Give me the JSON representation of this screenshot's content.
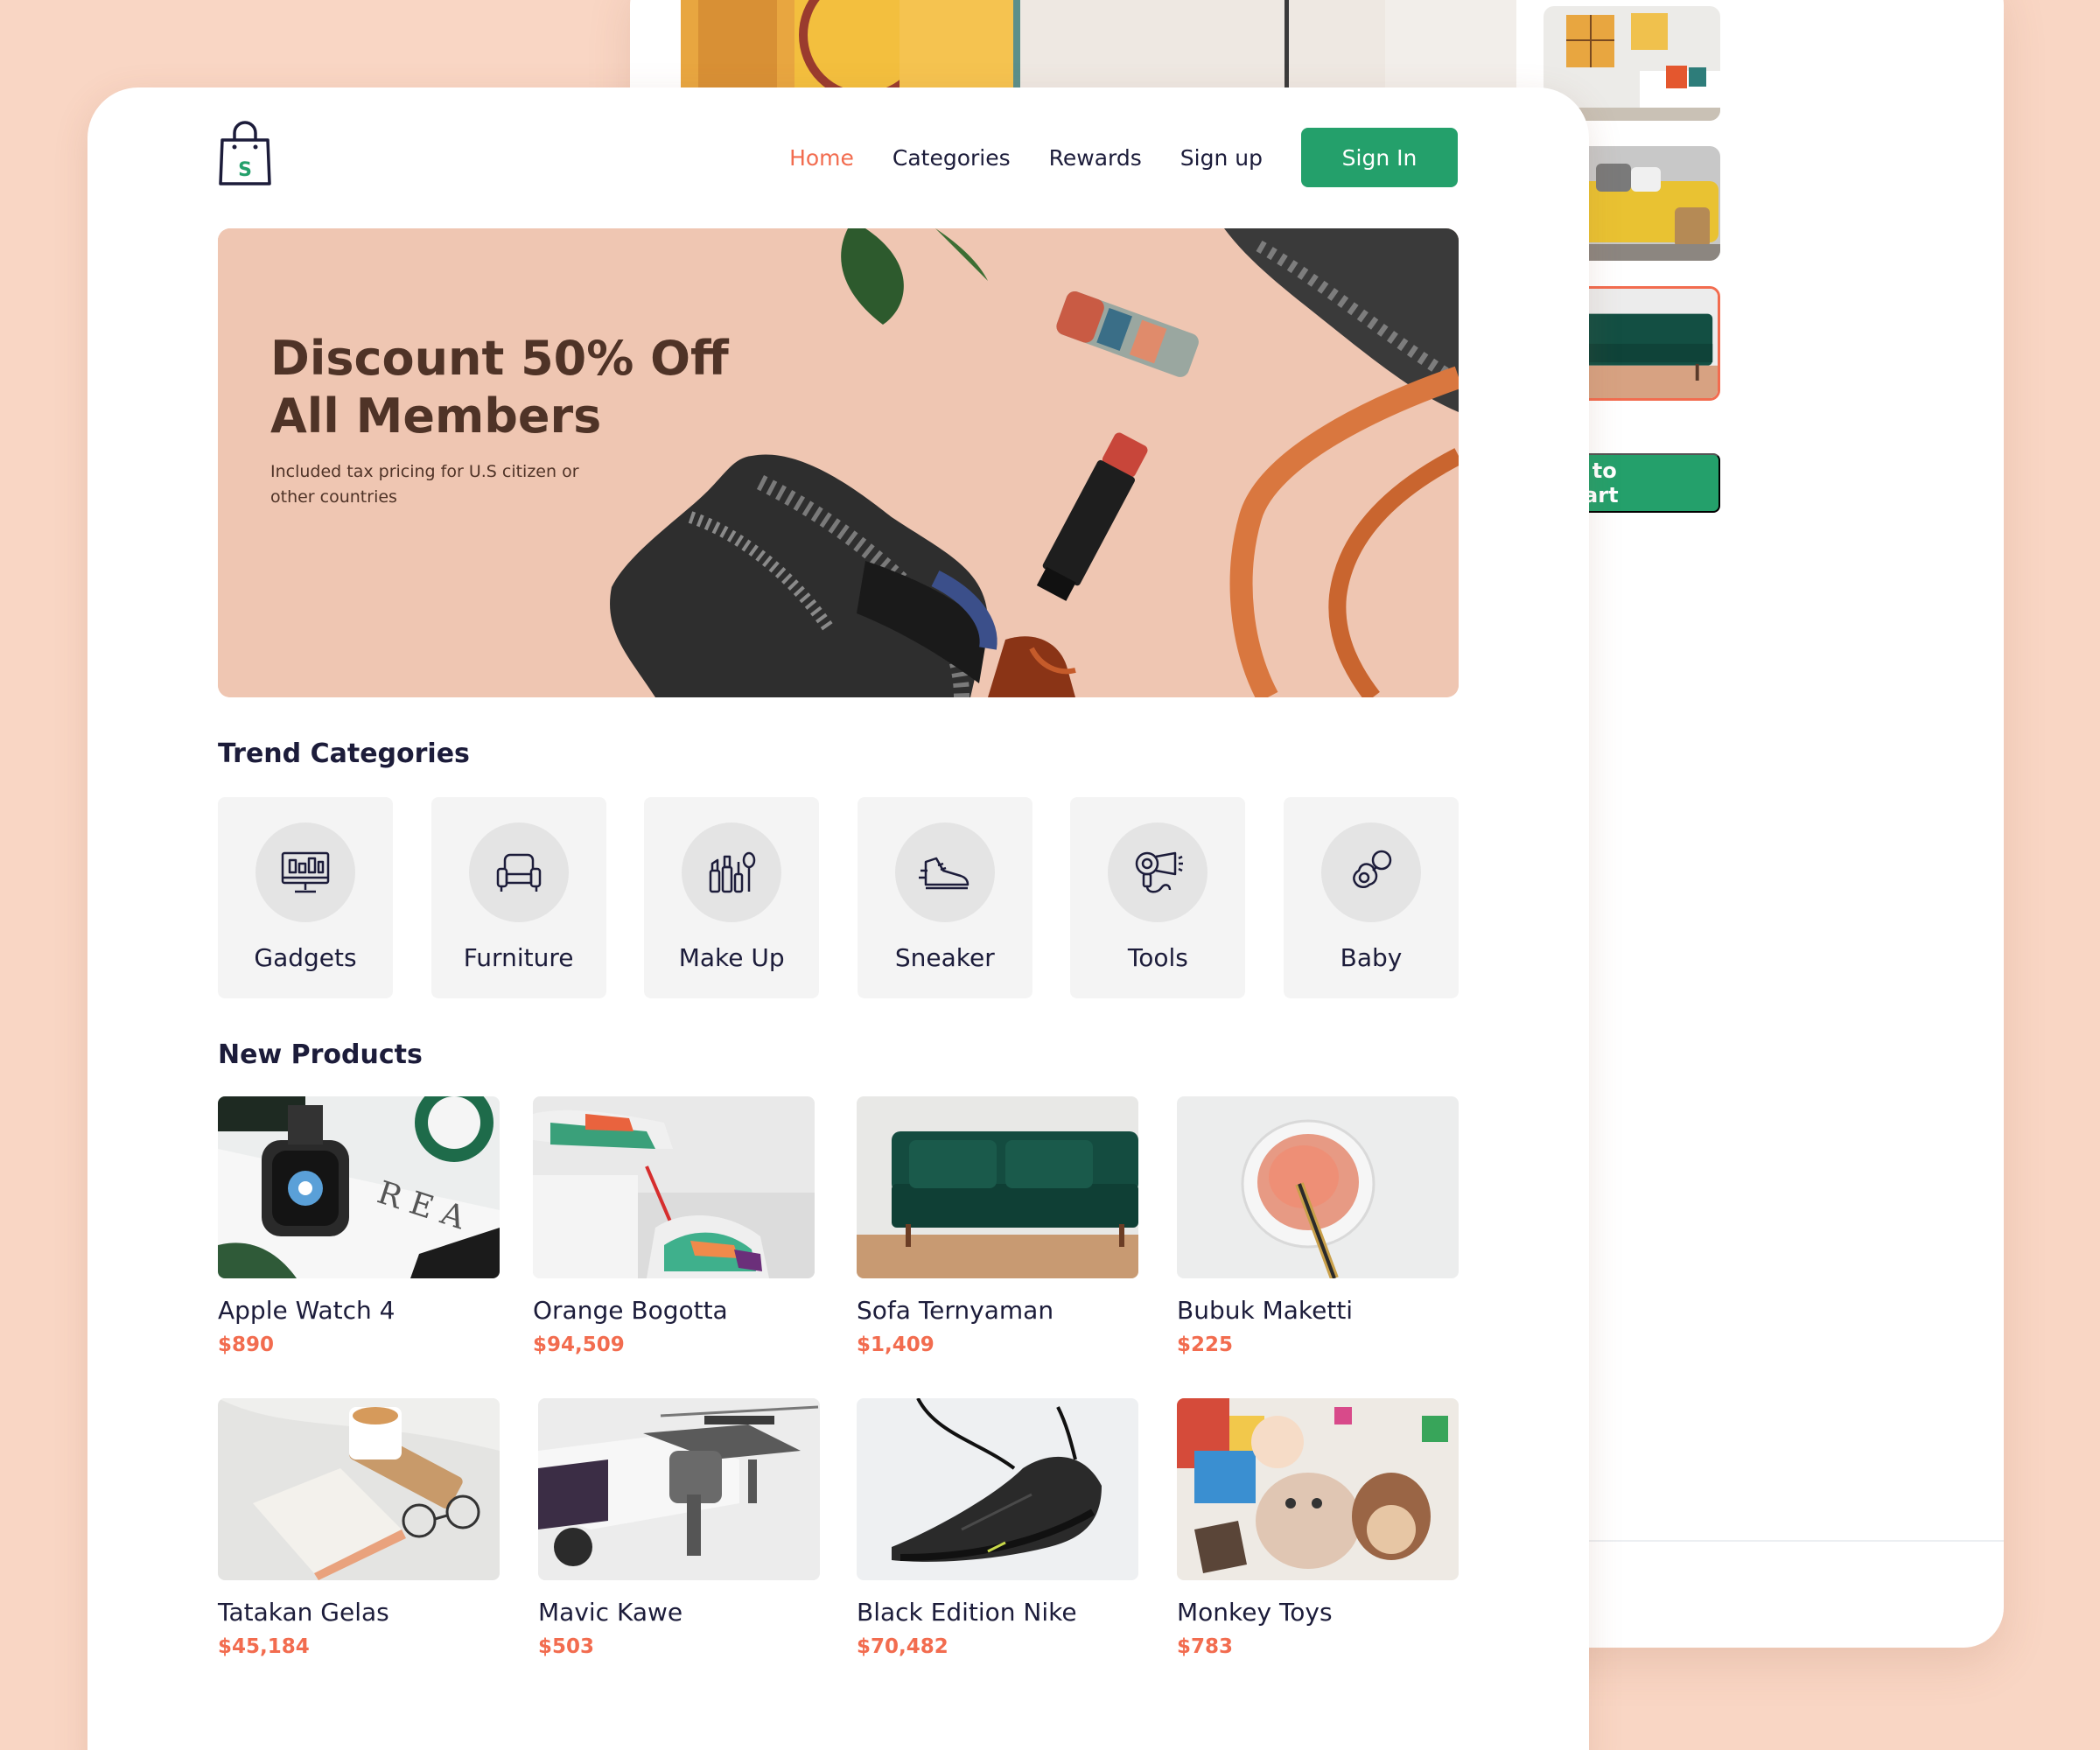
{
  "back_page": {
    "add_to_cart_label": "d to Cart"
  },
  "header": {
    "nav": [
      "Home",
      "Categories",
      "Rewards",
      "Sign up"
    ],
    "sign_in_label": "Sign In"
  },
  "hero": {
    "title": "Discount 50% Off All Members",
    "subtitle": "Included tax pricing for U.S citizen or other countries"
  },
  "trend": {
    "title": "Trend Categories",
    "items": [
      {
        "label": "Gadgets",
        "icon": "monitor-icon"
      },
      {
        "label": "Furniture",
        "icon": "armchair-icon"
      },
      {
        "label": "Make Up",
        "icon": "makeup-icon"
      },
      {
        "label": "Sneaker",
        "icon": "sneaker-icon"
      },
      {
        "label": "Tools",
        "icon": "hair-dryer-icon"
      },
      {
        "label": "Baby",
        "icon": "pacifier-icon"
      }
    ]
  },
  "new_products": {
    "title": "New Products",
    "items": [
      {
        "name": "Apple Watch 4",
        "price": "$890"
      },
      {
        "name": "Orange Bogotta",
        "price": "$94,509"
      },
      {
        "name": "Sofa Ternyaman",
        "price": "$1,409"
      },
      {
        "name": "Bubuk Maketti",
        "price": "$225"
      },
      {
        "name": "Tatakan Gelas",
        "price": "$45,184"
      },
      {
        "name": "Mavic Kawe",
        "price": "$503"
      },
      {
        "name": "Black Edition Nike",
        "price": "$70,482"
      },
      {
        "name": "Monkey Toys",
        "price": "$783"
      }
    ]
  },
  "colors": {
    "background": "#f9d6c4",
    "accent": "#f26c4f",
    "primary": "#24a06b",
    "text": "#1c1c3a"
  }
}
